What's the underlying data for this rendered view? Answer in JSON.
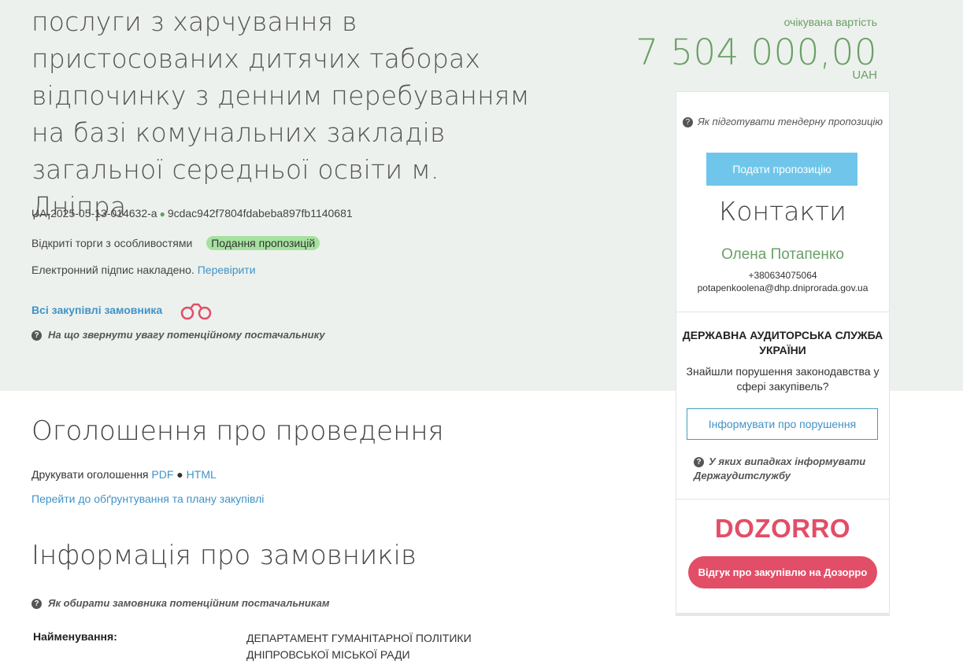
{
  "title": "послуги з харчування в пристосованих дитячих таборах відпочинку з денним перебуванням на базі комунальних закладів загальної середньої освіти м. Дніпра",
  "tender": {
    "id": "UA-2025-05-13-014632-a",
    "hash": "9cdac942f7804fdabeba897fb1140681",
    "procedure": "Відкриті торги з особливостями",
    "status": "Подання пропозицій",
    "signature_text": "Електронний підпис накладено.",
    "signature_link": "Перевірити",
    "all_purchases": "Всі закупівлі замовника",
    "hint_attention": "На що звернути увагу потенційному постачальнику"
  },
  "price": {
    "label": "очікувана вартість",
    "value": "7 504 000,00",
    "currency": "UAH"
  },
  "sidebar": {
    "prepare_hint": "Як підготувати тендерну пропозицію",
    "submit_button": "Подати пропозицію",
    "contacts_title": "Контакти",
    "contact_name": "Олена Потапенко",
    "contact_phone": "+380634075064",
    "contact_email": "potapenkoolena@dhp.dniprorada.gov.ua",
    "dasu_title": "ДЕРЖАВНА АУДИТОРСЬКА СЛУЖБА УКРАЇНИ",
    "dasu_question": "Знайшли порушення законодавства у сфері закупівель?",
    "inform_button": "Інформувати про порушення",
    "dasu_hint": "У яких випадках інформувати Держаудитслужбу",
    "dozorro_logo": "DOZORRO",
    "dozorro_button": "Відгук про закупівлю на Дозорро"
  },
  "announcement": {
    "title": "Оголошення про проведення",
    "print_label": "Друкувати оголошення",
    "pdf": "PDF",
    "html": "HTML",
    "plan_link": "Перейти до обґрунтування та плану закупівлі"
  },
  "customers": {
    "title": "Інформація про замовників",
    "hint": "Як обирати замовника потенційним постачальникам",
    "name_label": "Найменування:",
    "name_value": "ДЕПАРТАМЕНТ ГУМАНІТАРНОЇ ПОЛІТИКИ ДНІПРОВСЬКОЇ МІСЬКОЇ РАДИ"
  },
  "colors": {
    "band": "#edf1ed",
    "green": "#6aa067",
    "link": "#3f93c7",
    "submit": "#6fc6ea",
    "dozorro": "#e24e67",
    "status_pill": "#a5e19f"
  }
}
